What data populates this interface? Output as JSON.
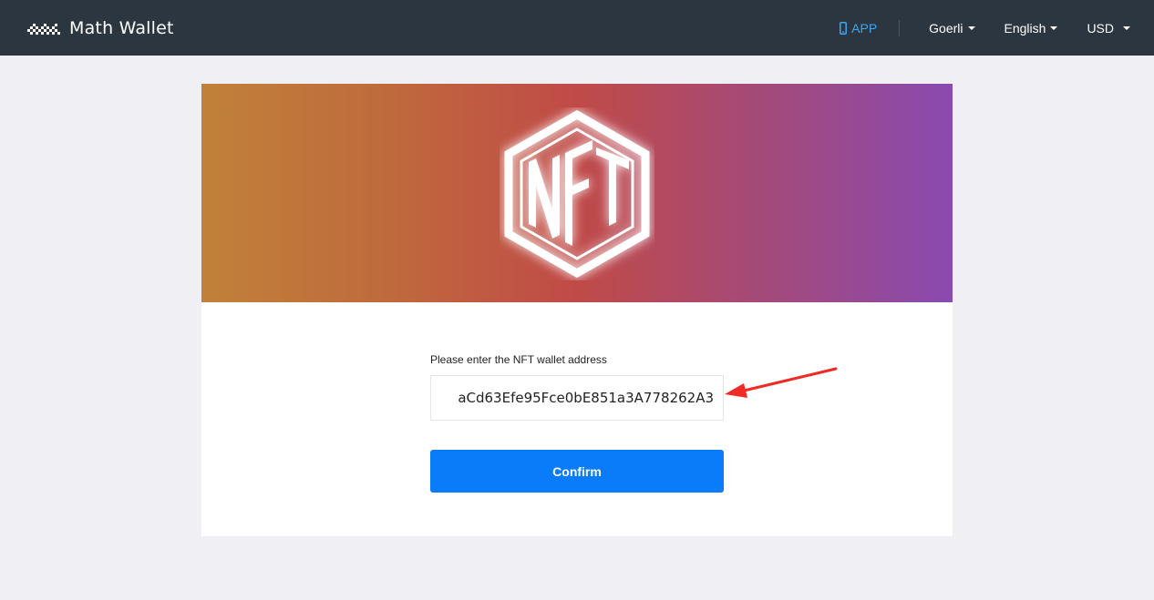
{
  "header": {
    "brand_name": "Math Wallet",
    "logo_icon": "math-wallet-logo-icon",
    "app_label": "APP",
    "app_icon": "phone-icon",
    "network_label": "Goerli",
    "language_label": "English",
    "currency_label": "USD"
  },
  "banner": {
    "logo_text": "NFT",
    "logo_icon": "nft-hexagon-icon"
  },
  "form": {
    "address_label": "Please enter the NFT wallet address",
    "address_value": "aCd63Efe95Fce0bE851a3A778262A3",
    "confirm_label": "Confirm"
  },
  "annotation": {
    "icon": "red-arrow-icon"
  },
  "colors": {
    "navbar": "#2c3640",
    "app_link": "#3da7f3",
    "confirm_button": "#0a7cfa",
    "page_background": "#f0eff4",
    "annotation_arrow": "#f02a24"
  }
}
